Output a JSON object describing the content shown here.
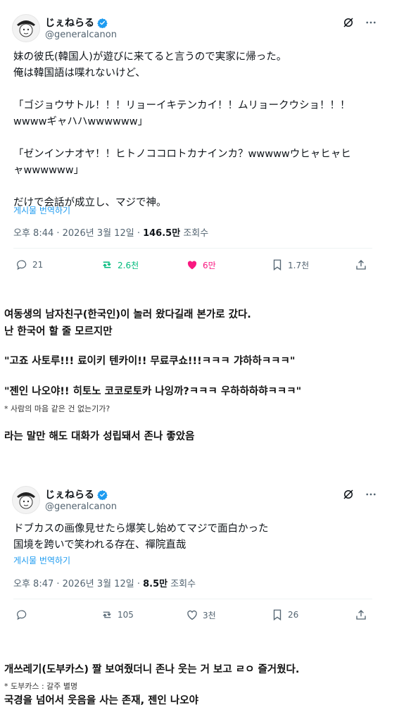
{
  "tweet1": {
    "display_name": "じぇねらる",
    "handle": "@generalcanon",
    "text": "妹の彼氏(韓国人)が遊びに来てると言うので実家に帰った。\n俺は韓国語は喋れないけど、\n\n「ゴジョウサトル！！！リョーイキテンカイ！！ムリョークウショ！！！\nwwwwギャハハwwwwww」\n\n「ゼンインナオヤ！！ヒトノココロトカナインカ？wwwwwウヒャヒャヒ\nャwwwwww」\n\nだけで会話が成立し、マジで神。",
    "translate": "게시물 번역하기",
    "time": "오후 8:44 · 2026년 3월 12일 · ",
    "views": "146.5만",
    "views_label": " 조회수",
    "replies": "21",
    "reposts": "2.6천",
    "likes": "6만",
    "bookmarks": "1.7천"
  },
  "caption1": {
    "line1": "여동생의 남자친구(한국인)이 놀러 왔다길래 본가로 갔다.",
    "line2": "난 한국어 할 줄 모르지만",
    "line3": "\"고죠 사토루!!! 료이키 텐카이!! 무료쿠쇼!!!ㅋㅋㅋ 갸하하ㅋㅋㅋ\"",
    "line4": "\"젠인 나오야!! 히토노 코코로토카 나잉까?ㅋㅋㅋ 우하하하햐ㅋㅋㅋ\"",
    "note": "* 사람의 마음 같은 건 없는기가?",
    "line5": "라는 말만 해도 대화가 성립돼서 존나 좋았음"
  },
  "tweet2": {
    "display_name": "じぇねらる",
    "handle": "@generalcanon",
    "text": "ドブカスの画像見せたら爆笑し始めてマジで面白かった\n国境を跨いで笑われる存在、禪院直哉",
    "translate": "게시물 번역하기",
    "time": "오후 8:47 · 2026년 3월 12일 · ",
    "views": "8.5만",
    "views_label": " 조회수",
    "replies": "",
    "reposts": "105",
    "likes": "3천",
    "bookmarks": "26"
  },
  "caption2": {
    "line1": "개쓰레기(도부카스) 짤 보여줬더니 존나 웃는 거 보고 ㄹㅇ 즐거웠다.",
    "note": "* 도부카스 : 갈주 별명",
    "line2": "국경을 넘어서 웃음을 사는 존재, 젠인 나오야"
  },
  "colors": {
    "verified": "#1d9bf0",
    "repost": "#00ba7c",
    "like": "#f91880",
    "muted": "#536471"
  }
}
